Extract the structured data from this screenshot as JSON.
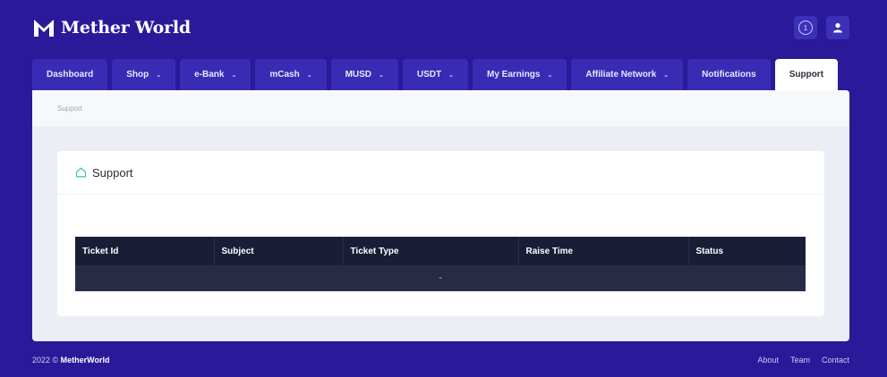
{
  "brand": {
    "name": "Mether World",
    "logo_icon": "mw-logo-icon"
  },
  "header": {
    "notification_count": "1",
    "notification_icon": "circle-count-icon",
    "user_icon": "user-icon"
  },
  "tabs": [
    {
      "label": "Dashboard",
      "dropdown": false
    },
    {
      "label": "Shop",
      "dropdown": true
    },
    {
      "label": "e-Bank",
      "dropdown": true
    },
    {
      "label": "mCash",
      "dropdown": true
    },
    {
      "label": "MUSD",
      "dropdown": true
    },
    {
      "label": "USDT",
      "dropdown": true
    },
    {
      "label": "My Earnings",
      "dropdown": true
    },
    {
      "label": "Affiliate Network",
      "dropdown": true
    },
    {
      "label": "Notifications",
      "dropdown": false
    },
    {
      "label": "Support",
      "dropdown": false,
      "active": true
    }
  ],
  "breadcrumb": "Support",
  "card": {
    "title": "Support",
    "icon": "home-icon"
  },
  "table": {
    "columns": [
      "Ticket Id",
      "Subject",
      "Ticket Type",
      "Raise Time",
      "Status"
    ],
    "empty_text": "-"
  },
  "footer": {
    "year": "2022 ©",
    "brand": "MetherWorld",
    "links": [
      "About",
      "Team",
      "Contact"
    ]
  },
  "colors": {
    "background": "#2a1a9a",
    "tab": "#3a2bb4",
    "table_header": "#1a1d36",
    "table_row": "#272b45",
    "home_icon": "#3fc9c1"
  }
}
